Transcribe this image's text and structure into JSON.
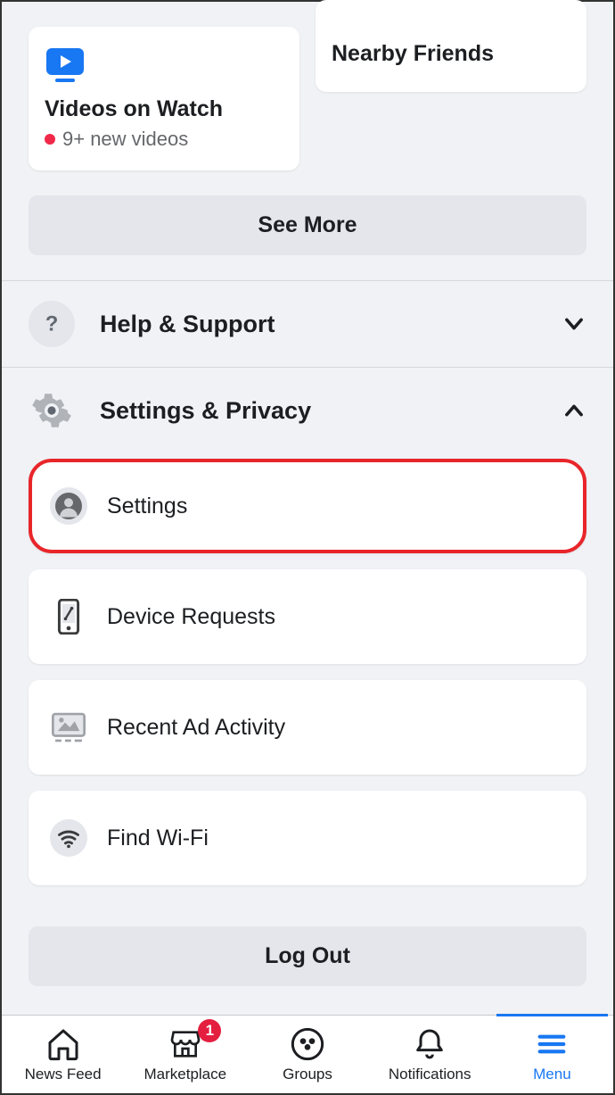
{
  "shortcuts": {
    "watch": {
      "title": "Videos on Watch",
      "subtitle": "9+ new videos"
    },
    "nearby": {
      "title": "Nearby Friends"
    }
  },
  "see_more_label": "See More",
  "sections": {
    "help": {
      "title": "Help & Support",
      "expanded": false
    },
    "settings_privacy": {
      "title": "Settings & Privacy",
      "expanded": true,
      "items": [
        {
          "label": "Settings"
        },
        {
          "label": "Device Requests"
        },
        {
          "label": "Recent Ad Activity"
        },
        {
          "label": "Find Wi-Fi"
        }
      ]
    }
  },
  "logout_label": "Log Out",
  "tabbar": {
    "items": [
      {
        "label": "News Feed"
      },
      {
        "label": "Marketplace",
        "badge": "1"
      },
      {
        "label": "Groups"
      },
      {
        "label": "Notifications"
      },
      {
        "label": "Menu",
        "active": true
      }
    ]
  }
}
